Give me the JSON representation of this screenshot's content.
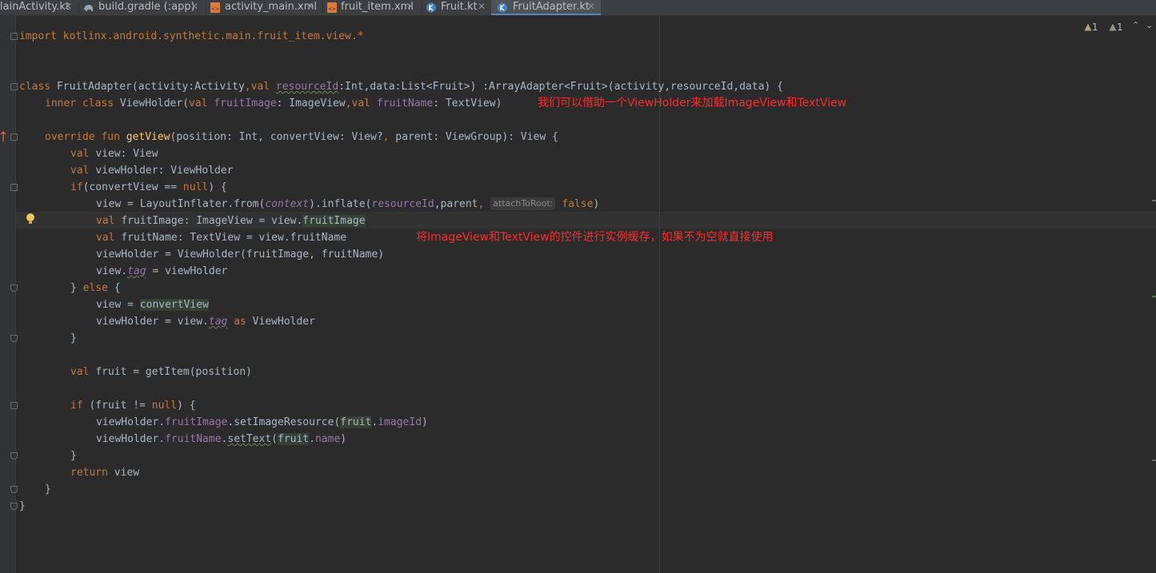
{
  "tabs": [
    {
      "label": "MainActivity.kt",
      "display": "lainActivity.kt",
      "icon": "kotlin-file-icon",
      "active": false
    },
    {
      "label": "build.gradle (:app)",
      "icon": "gradle-elephant-icon",
      "active": false
    },
    {
      "label": "activity_main.xml",
      "icon": "xml-layout-icon",
      "active": false
    },
    {
      "label": "fruit_item.xml",
      "icon": "xml-layout-icon",
      "active": false
    },
    {
      "label": "Fruit.kt",
      "icon": "kotlin-class-icon",
      "active": false
    },
    {
      "label": "FruitAdapter.kt",
      "icon": "kotlin-class-icon",
      "active": true
    }
  ],
  "inspection": {
    "warnings": "1",
    "weak_warnings": "1"
  },
  "code": {
    "l1": "import kotlinx.android.synthetic.main.fruit_item.view.*",
    "l4_kw1": "class ",
    "l4_a": "FruitAdapter(activity:Activity",
    "l4_comma": ",",
    "l4_kw2": "val ",
    "l4_param": "resourceId",
    "l4_b": ":Int,data:List<Fruit>) :ArrayAdapter<Fruit>(activity,resourceId,data) {",
    "l5_kw1": "inner class ",
    "l5_a": "ViewHolder(",
    "l5_kw2": "val ",
    "l5_p1": "fruitImage",
    "l5_b": ": ImageView",
    "l5_comma": ",",
    "l5_kw3": "val ",
    "l5_p2": "fruitName",
    "l5_c": ": TextView)",
    "l7_kw": "override fun ",
    "l7_fn": "getView",
    "l7_a": "(position: Int, convertView: View?",
    "l7_comma": ",",
    "l7_b": " parent: ViewGroup): View {",
    "l8_kw": "val ",
    "l8_a": "view: View",
    "l9_kw": "val ",
    "l9_a": "viewHolder: ViewHolder",
    "l10_kw": "if",
    "l10_a": "(convertView == ",
    "l10_null": "null",
    "l10_b": ") {",
    "l11_a": "view = LayoutInflater.from(",
    "l11_ctx": "context",
    "l11_b": ").inflate(",
    "l11_res": "resourceId",
    "l11_c": ",parent",
    "l11_comma": ",",
    "l11_hint": "attachToRoot:",
    "l11_false": "false",
    "l11_d": ")",
    "l12_kw": "val ",
    "l12_a": "fruitImage: ImageView = view.",
    "l12_b": "fruitImage",
    "l13_kw": "val ",
    "l13_a": "fruitName: TextView = view.fruitName",
    "l14": "viewHolder = ViewHolder(fruitImage, fruitName)",
    "l15_a": "view.",
    "l15_tag": "tag",
    "l15_b": " = viewHolder",
    "l16_a": "} ",
    "l16_kw": "else",
    "l16_b": " {",
    "l17_a": "view = ",
    "l17_b": "convertView",
    "l18_a": "viewHolder = view.",
    "l18_tag": "tag",
    "l18_kw": " as",
    "l18_b": " ViewHolder",
    "l19": "}",
    "l21_kw": "val ",
    "l21_a": "fruit = getItem(position)",
    "l23_kw": "if",
    "l23_a": " (fruit != ",
    "l23_null": "null",
    "l23_b": ") {",
    "l24_a": "viewHolder.",
    "l24_p": "fruitImage",
    "l24_b": ".setImageResource(",
    "l24_c": "fruit",
    "l24_d": ".",
    "l24_e": "imageId",
    "l24_f": ")",
    "l25_a": "viewHolder.",
    "l25_p": "fruitName",
    "l25_b": ".",
    "l25_set": "setText",
    "l25_c": "(",
    "l25_d": "fruit",
    "l25_e": ".",
    "l25_f": "name",
    "l25_g": ")",
    "l26": "}",
    "l27_kw": "return",
    "l27_a": " view",
    "l28": "}",
    "l29": "}"
  },
  "annotations": {
    "viewholder_note": "我们可以借助一个ViewHolder来加载ImageView和TextView",
    "cache_note": "将ImageView和TextView的控件进行实例缓存，如果不为空就直接使用"
  },
  "colors": {
    "annotation": "#ff2a2a",
    "keyword": "#cc7832",
    "property": "#9876aa",
    "function": "#ffc66d"
  }
}
